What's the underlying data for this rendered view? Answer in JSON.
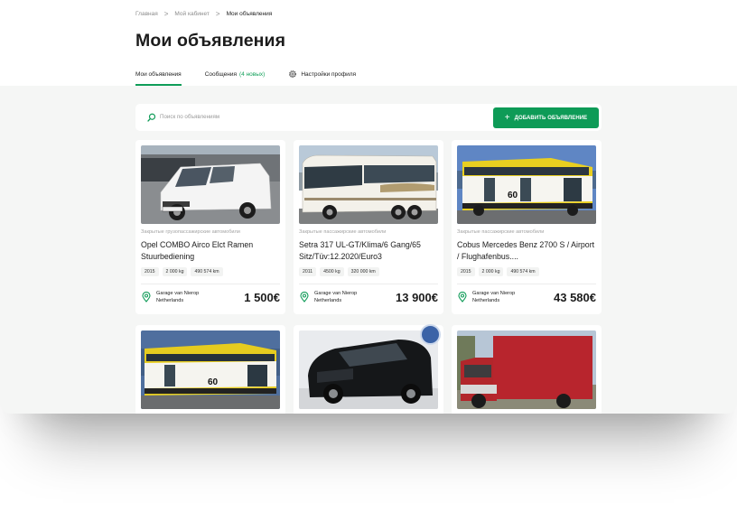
{
  "breadcrumbs": [
    "Главная",
    "Мой кабинет",
    "Мои объявления"
  ],
  "breadcrumb_separator": ">",
  "page_title": "Мои объявления",
  "tabs": [
    {
      "label": "Мои объявления",
      "active": true
    },
    {
      "label": "Сообщения",
      "note": "(4 новых)"
    },
    {
      "label": "Настройки профиля",
      "icon": "gear-icon"
    }
  ],
  "search": {
    "placeholder": "Поиск по объявлениям",
    "icon": "search-icon"
  },
  "add_button": {
    "icon": "plus-icon",
    "label": "ДОБАВИТЬ ОБЪЯВЛЕНИЕ"
  },
  "colors": {
    "accent": "#0e9b57",
    "price": "#1c1c1c",
    "muted": "#9a9a9a",
    "page_bg": "#f5f6f5"
  },
  "listings": [
    {
      "category": "Закрытые грузопассажирские автомобили",
      "title": "Opel COMBO Airco Elct Ramen Stuurbediening",
      "specs": [
        "2015",
        "2 000 kg",
        "490 574 km"
      ],
      "location": [
        "Garage van Nierop",
        "Netherlands"
      ],
      "price": "1 500€",
      "photo": "white-van"
    },
    {
      "category": "Закрытые пассажирские автомобили",
      "title": "Setra 317 UL-GT/Klima/6 Gang/65 Sitz/Tüv:12.2020/Euro3",
      "specs": [
        "2011",
        "4500 kg",
        "320 000 km"
      ],
      "location": [
        "Garage van Nierop",
        "Netherlands"
      ],
      "price": "13 900€",
      "photo": "white-coach"
    },
    {
      "category": "Закрытые пассажирские автомобили",
      "title": "Cobus Mercedes Benz 2700 S / Airport / Flughafenbus....",
      "specs": [
        "2015",
        "2 000 kg",
        "490 574 km"
      ],
      "location": [
        "Garage van Nierop",
        "Netherlands"
      ],
      "price": "43 580€",
      "photo": "yellow-apron-bus"
    },
    {
      "photo": "yellow-apron-bus"
    },
    {
      "photo": "black-minivan"
    },
    {
      "photo": "red-truck"
    }
  ]
}
